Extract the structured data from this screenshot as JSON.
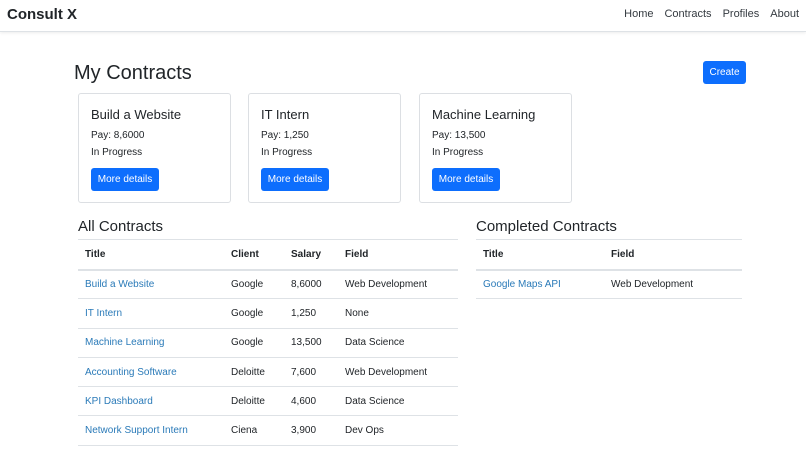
{
  "nav": {
    "brand": "Consult X",
    "links": [
      "Home",
      "Contracts",
      "Profiles",
      "About"
    ]
  },
  "page": {
    "title": "My Contracts",
    "create_label": "Create"
  },
  "cards": [
    {
      "title": "Build a Website",
      "pay": "Pay: 8,6000",
      "status": "In Progress",
      "button": "More details"
    },
    {
      "title": "IT Intern",
      "pay": "Pay: 1,250",
      "status": "In Progress",
      "button": "More details"
    },
    {
      "title": "Machine Learning",
      "pay": "Pay: 13,500",
      "status": "In Progress",
      "button": "More details"
    }
  ],
  "all_contracts": {
    "title": "All Contracts",
    "headers": [
      "Title",
      "Client",
      "Salary",
      "Field"
    ],
    "rows": [
      [
        "Build a Website",
        "Google",
        "8,6000",
        "Web Development"
      ],
      [
        "IT Intern",
        "Google",
        "1,250",
        "None"
      ],
      [
        "Machine Learning",
        "Google",
        "13,500",
        "Data Science"
      ],
      [
        "Accounting Software",
        "Deloitte",
        "7,600",
        "Web Development"
      ],
      [
        "KPI Dashboard",
        "Deloitte",
        "4,600",
        "Data Science"
      ],
      [
        "Network Support Intern",
        "Ciena",
        "3,900",
        "Dev Ops"
      ]
    ]
  },
  "completed_contracts": {
    "title": "Completed Contracts",
    "headers": [
      "Title",
      "Field"
    ],
    "rows": [
      [
        "Google Maps API",
        "Web Development"
      ]
    ]
  },
  "colors": {
    "primary": "#0d6efd",
    "link": "#2a7ab8"
  }
}
